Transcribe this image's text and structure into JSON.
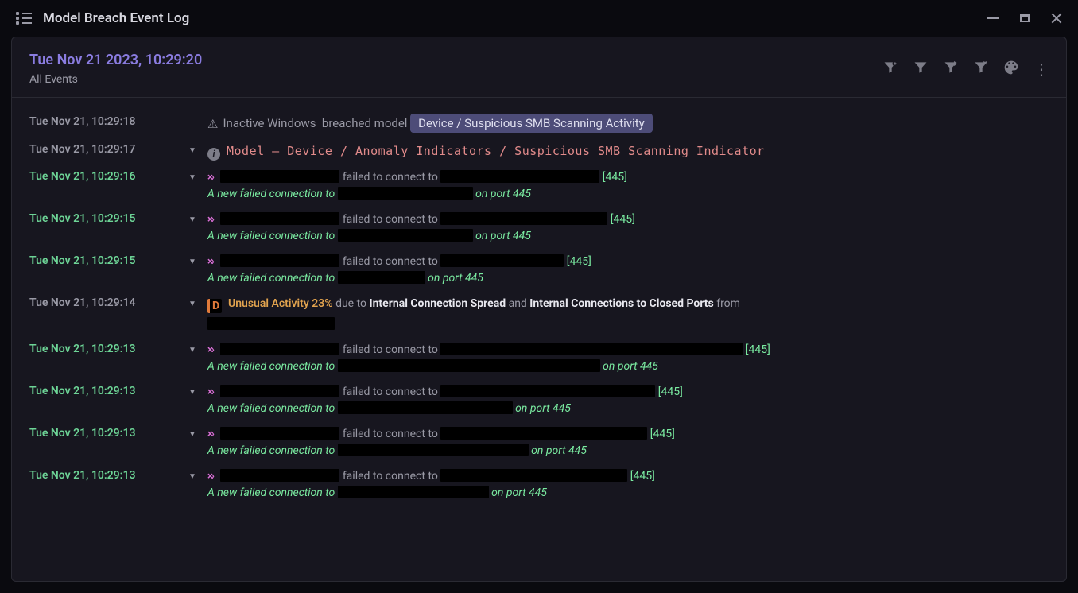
{
  "window": {
    "title": "Model Breach Event Log"
  },
  "header": {
    "datetime": "Tue Nov 21 2023, 10:29:20",
    "subtitle": "All Events"
  },
  "labels": {
    "breached_prefix": "Inactive Windows",
    "breached_mid": "breached model",
    "model_prefix": "Model —",
    "failed_mid": "failed to connect to",
    "sub_prefix": "A new failed connection to",
    "sub_port": "on port 445",
    "unusual_label": "Unusual Activity",
    "due_to": "due to",
    "and": "and",
    "from": "from"
  },
  "events": [
    {
      "ts": "Tue Nov 21, 10:29:18",
      "ts_class": "muted",
      "chev": false,
      "kind": "breach",
      "pill": "Device / Suspicious SMB Scanning Activity"
    },
    {
      "ts": "Tue Nov 21, 10:29:17",
      "ts_class": "muted",
      "chev": true,
      "kind": "model",
      "model_path": "Device / Anomaly Indicators / Suspicious SMB Scanning Indicator"
    },
    {
      "ts": "Tue Nov 21, 10:29:16",
      "ts_class": "green",
      "chev": true,
      "kind": "conn",
      "r1": 150,
      "r2": 200,
      "r3": 170,
      "port": "[445]"
    },
    {
      "ts": "Tue Nov 21, 10:29:15",
      "ts_class": "green",
      "chev": true,
      "kind": "conn",
      "r1": 150,
      "r2": 210,
      "r3": 170,
      "port": "[445]"
    },
    {
      "ts": "Tue Nov 21, 10:29:15",
      "ts_class": "green",
      "chev": true,
      "kind": "conn",
      "r1": 150,
      "r2": 155,
      "r3": 110,
      "port": "[445]"
    },
    {
      "ts": "Tue Nov 21, 10:29:14",
      "ts_class": "muted",
      "chev": true,
      "kind": "unusual",
      "pct": "23%",
      "cause1": "Internal Connection Spread",
      "cause2": "Internal Connections to Closed Ports",
      "r_from": 160
    },
    {
      "ts": "Tue Nov 21, 10:29:13",
      "ts_class": "green",
      "chev": true,
      "kind": "conn",
      "r1": 150,
      "r2": 380,
      "r3": 330,
      "port": "[445]"
    },
    {
      "ts": "Tue Nov 21, 10:29:13",
      "ts_class": "green",
      "chev": true,
      "kind": "conn",
      "r1": 150,
      "r2": 270,
      "r3": 220,
      "port": "[445]"
    },
    {
      "ts": "Tue Nov 21, 10:29:13",
      "ts_class": "green",
      "chev": true,
      "kind": "conn",
      "r1": 150,
      "r2": 260,
      "r3": 240,
      "port": "[445]"
    },
    {
      "ts": "Tue Nov 21, 10:29:13",
      "ts_class": "green",
      "chev": true,
      "kind": "conn",
      "r1": 150,
      "r2": 235,
      "r3": 190,
      "port": "[445]"
    }
  ]
}
